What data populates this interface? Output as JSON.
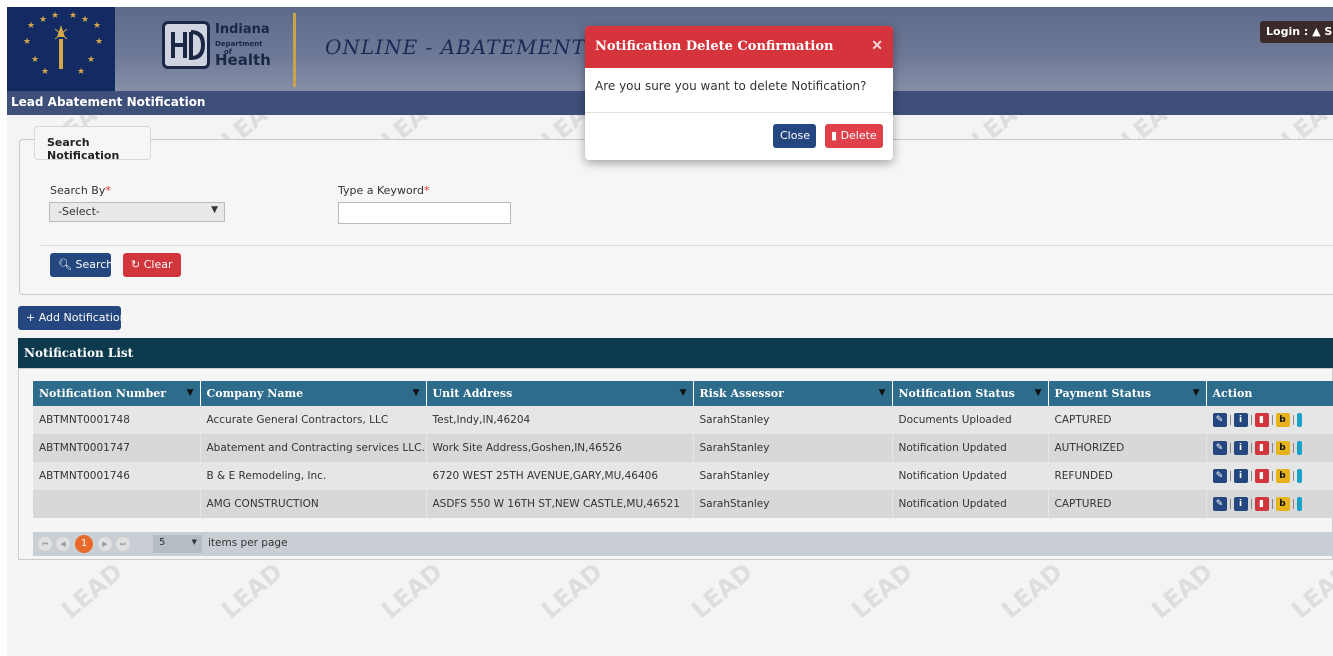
{
  "header": {
    "logo_line1": "Indiana",
    "logo_line2": "Department",
    "logo_line3": "of",
    "logo_line4": "Health",
    "app_title": "ONLINE - ABATEMENT N",
    "login_label": "Login : ▲ S"
  },
  "subbar": {
    "title": "Lead Abatement Notification"
  },
  "search": {
    "legend": "Search Notification",
    "search_by_label": "Search By",
    "search_by_value": "-Select-",
    "keyword_label": "Type a Keyword",
    "keyword_value": "",
    "required_mark": "*",
    "search_button": "Search",
    "clear_button": "Clear"
  },
  "add_button": "+ Add Notification",
  "list": {
    "title": "Notification List",
    "columns": [
      "Notification Number",
      "Company Name",
      "Unit Address",
      "Risk Assessor",
      "Notification Status",
      "Payment Status",
      "Action"
    ],
    "rows": [
      {
        "number": "ABTMNT0001748",
        "company": "Accurate General Contractors, LLC",
        "address": "Test,Indy,IN,46204",
        "assessor": "SarahStanley",
        "status": "Documents Uploaded",
        "payment": "CAPTURED"
      },
      {
        "number": "ABTMNT0001747",
        "company": "Abatement and Contracting services LLC.",
        "address": "Work Site Address,Goshen,IN,46526",
        "assessor": "SarahStanley",
        "status": "Notification Updated",
        "payment": "AUTHORIZED"
      },
      {
        "number": "ABTMNT0001746",
        "company": "B & E Remodeling, Inc.",
        "address": "6720 WEST 25TH AVENUE,GARY,MU,46406",
        "assessor": "SarahStanley",
        "status": "Notification Updated",
        "payment": "REFUNDED"
      },
      {
        "number": "",
        "company": "AMG CONSTRUCTION",
        "address": "ASDFS 550 W 16TH ST,NEW CASTLE,MU,46521",
        "assessor": "SarahStanley",
        "status": "Notification Updated",
        "payment": "CAPTURED"
      }
    ],
    "pager": {
      "current_page": "1",
      "page_size": "5",
      "items_per_page_label": "items per page"
    }
  },
  "modal": {
    "title": "Notification Delete Confirmation",
    "message": "Are you sure you want to delete Notification?",
    "close_button": "Close",
    "delete_button": "Delete"
  },
  "watermark": "LEAD",
  "colors": {
    "primary": "#24477f",
    "danger": "#d6343d",
    "list_header": "#0e3a4e",
    "grid_header": "#2e6c8c",
    "pager_active": "#e86a2a"
  }
}
